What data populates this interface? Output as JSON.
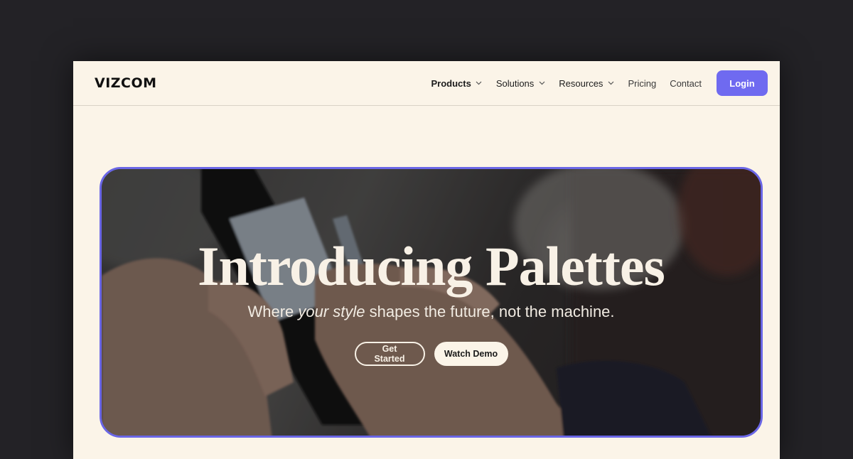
{
  "brand": {
    "logo_text": "VIZCOM"
  },
  "nav": {
    "items": [
      {
        "label": "Products",
        "has_dropdown": true,
        "bold": true
      },
      {
        "label": "Solutions",
        "has_dropdown": true,
        "bold": false
      },
      {
        "label": "Resources",
        "has_dropdown": true,
        "bold": false
      },
      {
        "label": "Pricing",
        "has_dropdown": false,
        "bold": false
      },
      {
        "label": "Contact",
        "has_dropdown": false,
        "bold": false
      }
    ],
    "login_label": "Login"
  },
  "hero": {
    "title": "Introducing Palettes",
    "subtitle_pre": "Where ",
    "subtitle_em": "your style",
    "subtitle_post": " shapes the future, not the machine.",
    "primary_cta": "Get Started",
    "secondary_cta": "Watch Demo",
    "background_image": "hands-holding-phone-photo"
  },
  "colors": {
    "page_bg": "#fbf4e8",
    "accent": "#6f6af0",
    "outer_bg": "#232226",
    "hero_border": "#6a66e6"
  }
}
